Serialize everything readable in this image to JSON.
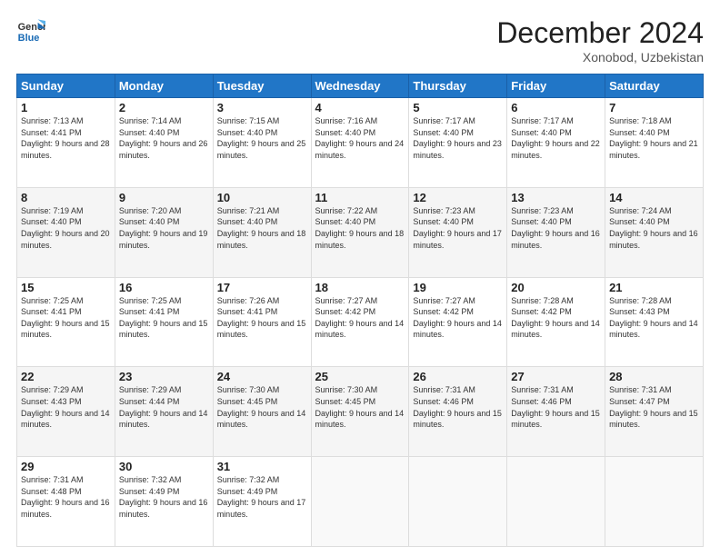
{
  "header": {
    "logo_line1": "General",
    "logo_line2": "Blue",
    "month": "December 2024",
    "location": "Xonobod, Uzbekistan"
  },
  "weekdays": [
    "Sunday",
    "Monday",
    "Tuesday",
    "Wednesday",
    "Thursday",
    "Friday",
    "Saturday"
  ],
  "weeks": [
    [
      {
        "day": "1",
        "sunrise": "7:13 AM",
        "sunset": "4:41 PM",
        "daylight": "9 hours and 28 minutes."
      },
      {
        "day": "2",
        "sunrise": "7:14 AM",
        "sunset": "4:40 PM",
        "daylight": "9 hours and 26 minutes."
      },
      {
        "day": "3",
        "sunrise": "7:15 AM",
        "sunset": "4:40 PM",
        "daylight": "9 hours and 25 minutes."
      },
      {
        "day": "4",
        "sunrise": "7:16 AM",
        "sunset": "4:40 PM",
        "daylight": "9 hours and 24 minutes."
      },
      {
        "day": "5",
        "sunrise": "7:17 AM",
        "sunset": "4:40 PM",
        "daylight": "9 hours and 23 minutes."
      },
      {
        "day": "6",
        "sunrise": "7:17 AM",
        "sunset": "4:40 PM",
        "daylight": "9 hours and 22 minutes."
      },
      {
        "day": "7",
        "sunrise": "7:18 AM",
        "sunset": "4:40 PM",
        "daylight": "9 hours and 21 minutes."
      }
    ],
    [
      {
        "day": "8",
        "sunrise": "7:19 AM",
        "sunset": "4:40 PM",
        "daylight": "9 hours and 20 minutes."
      },
      {
        "day": "9",
        "sunrise": "7:20 AM",
        "sunset": "4:40 PM",
        "daylight": "9 hours and 19 minutes."
      },
      {
        "day": "10",
        "sunrise": "7:21 AM",
        "sunset": "4:40 PM",
        "daylight": "9 hours and 18 minutes."
      },
      {
        "day": "11",
        "sunrise": "7:22 AM",
        "sunset": "4:40 PM",
        "daylight": "9 hours and 18 minutes."
      },
      {
        "day": "12",
        "sunrise": "7:23 AM",
        "sunset": "4:40 PM",
        "daylight": "9 hours and 17 minutes."
      },
      {
        "day": "13",
        "sunrise": "7:23 AM",
        "sunset": "4:40 PM",
        "daylight": "9 hours and 16 minutes."
      },
      {
        "day": "14",
        "sunrise": "7:24 AM",
        "sunset": "4:40 PM",
        "daylight": "9 hours and 16 minutes."
      }
    ],
    [
      {
        "day": "15",
        "sunrise": "7:25 AM",
        "sunset": "4:41 PM",
        "daylight": "9 hours and 15 minutes."
      },
      {
        "day": "16",
        "sunrise": "7:25 AM",
        "sunset": "4:41 PM",
        "daylight": "9 hours and 15 minutes."
      },
      {
        "day": "17",
        "sunrise": "7:26 AM",
        "sunset": "4:41 PM",
        "daylight": "9 hours and 15 minutes."
      },
      {
        "day": "18",
        "sunrise": "7:27 AM",
        "sunset": "4:42 PM",
        "daylight": "9 hours and 14 minutes."
      },
      {
        "day": "19",
        "sunrise": "7:27 AM",
        "sunset": "4:42 PM",
        "daylight": "9 hours and 14 minutes."
      },
      {
        "day": "20",
        "sunrise": "7:28 AM",
        "sunset": "4:42 PM",
        "daylight": "9 hours and 14 minutes."
      },
      {
        "day": "21",
        "sunrise": "7:28 AM",
        "sunset": "4:43 PM",
        "daylight": "9 hours and 14 minutes."
      }
    ],
    [
      {
        "day": "22",
        "sunrise": "7:29 AM",
        "sunset": "4:43 PM",
        "daylight": "9 hours and 14 minutes."
      },
      {
        "day": "23",
        "sunrise": "7:29 AM",
        "sunset": "4:44 PM",
        "daylight": "9 hours and 14 minutes."
      },
      {
        "day": "24",
        "sunrise": "7:30 AM",
        "sunset": "4:45 PM",
        "daylight": "9 hours and 14 minutes."
      },
      {
        "day": "25",
        "sunrise": "7:30 AM",
        "sunset": "4:45 PM",
        "daylight": "9 hours and 14 minutes."
      },
      {
        "day": "26",
        "sunrise": "7:31 AM",
        "sunset": "4:46 PM",
        "daylight": "9 hours and 15 minutes."
      },
      {
        "day": "27",
        "sunrise": "7:31 AM",
        "sunset": "4:46 PM",
        "daylight": "9 hours and 15 minutes."
      },
      {
        "day": "28",
        "sunrise": "7:31 AM",
        "sunset": "4:47 PM",
        "daylight": "9 hours and 15 minutes."
      }
    ],
    [
      {
        "day": "29",
        "sunrise": "7:31 AM",
        "sunset": "4:48 PM",
        "daylight": "9 hours and 16 minutes."
      },
      {
        "day": "30",
        "sunrise": "7:32 AM",
        "sunset": "4:49 PM",
        "daylight": "9 hours and 16 minutes."
      },
      {
        "day": "31",
        "sunrise": "7:32 AM",
        "sunset": "4:49 PM",
        "daylight": "9 hours and 17 minutes."
      },
      null,
      null,
      null,
      null
    ]
  ],
  "labels": {
    "sunrise": "Sunrise:",
    "sunset": "Sunset:",
    "daylight": "Daylight:"
  }
}
